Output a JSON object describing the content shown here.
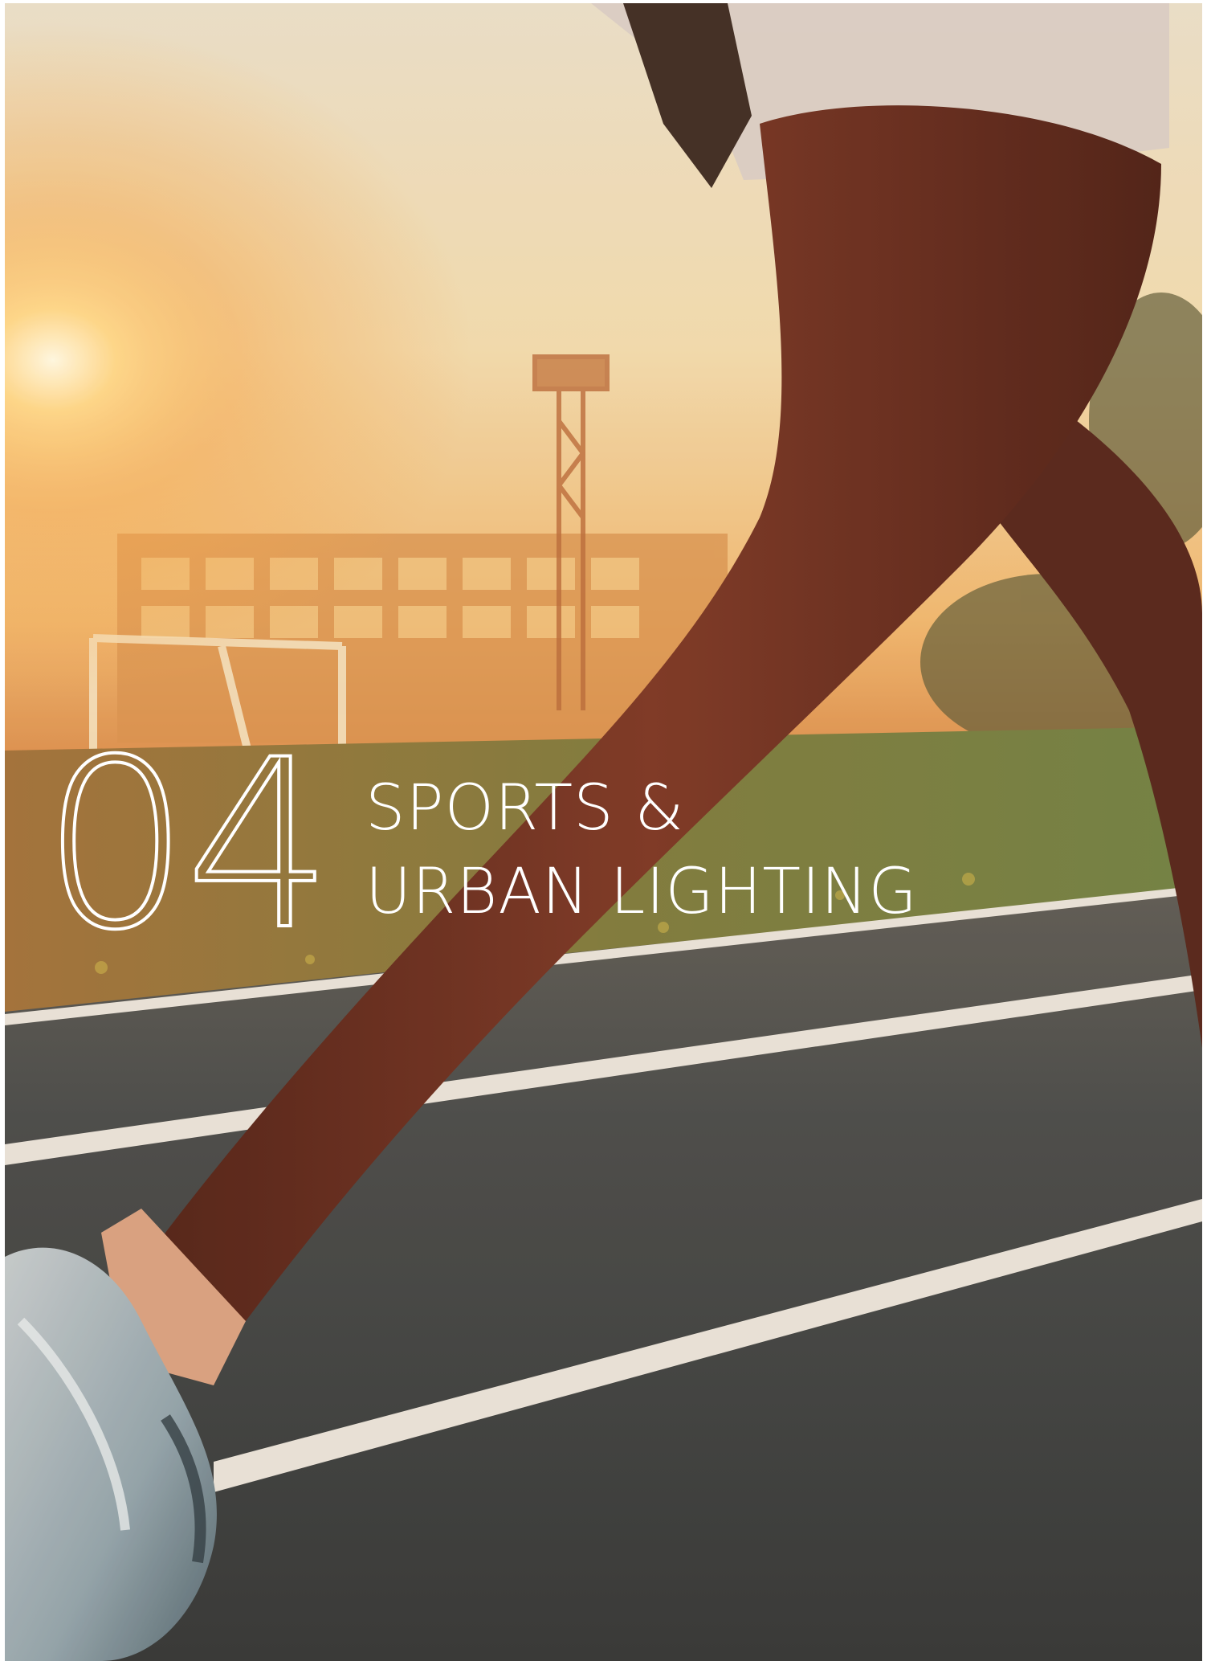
{
  "section": {
    "number": "04",
    "title_line_1": "SPORTS &",
    "title_line_2": "URBAN LIGHTING"
  },
  "photo": {
    "subject": "runner-on-athletics-track-at-sunset",
    "colors": {
      "sky": "#f3e2c0",
      "sun_glow": "#ffcc66",
      "leggings": "#6a2c1e",
      "track": "#3f4446",
      "lane_line": "#e8e4dc",
      "grass": "#6f7a3a",
      "shoe": "#8fa6b3"
    }
  }
}
